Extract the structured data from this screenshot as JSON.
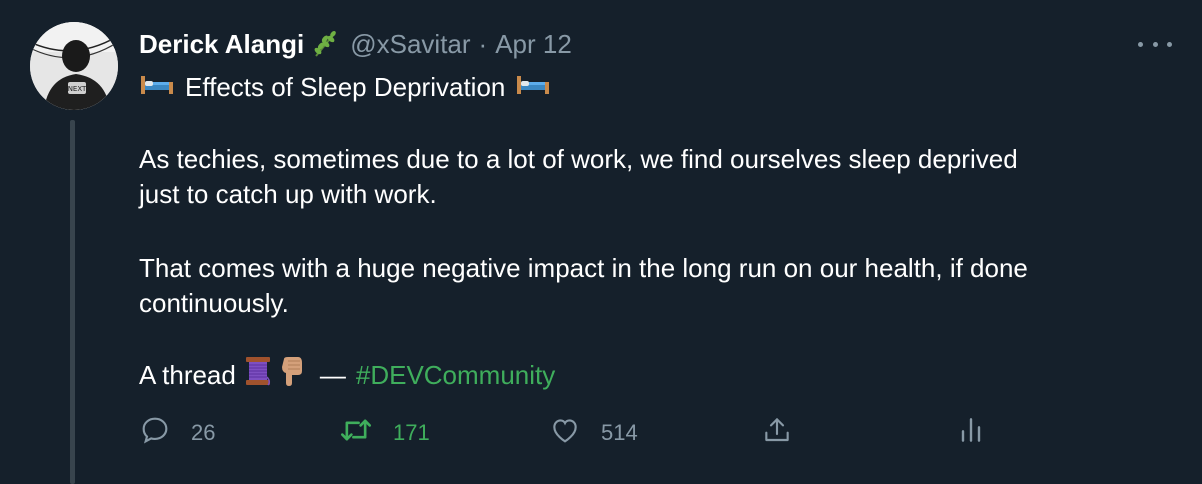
{
  "tweet": {
    "author_name": "Derick Alangi",
    "author_emoji": "🌿",
    "handle": "@xSavitar",
    "separator": "·",
    "date": "Apr 12",
    "title_line": "Effects of Sleep Deprivation",
    "paragraph1_line1": "As techies, sometimes due to a lot of work, we find ourselves sleep deprived",
    "paragraph1_line2": "just to catch up with work.",
    "paragraph2_line1": "That comes with a huge negative impact in the long run on our health, if done",
    "paragraph2_line2": "continuously.",
    "thread_text": "A thread",
    "thread_dash": "—",
    "hashtag": "#DEVCommunity"
  },
  "actions": {
    "reply_count": "26",
    "retweet_count": "171",
    "like_count": "514"
  },
  "icons": {
    "reply": "reply-icon",
    "retweet": "retweet-icon",
    "like": "heart-icon",
    "share": "share-icon",
    "analytics": "analytics-icon",
    "more": "more-icon"
  },
  "colors": {
    "background": "#15202b",
    "text": "#ffffff",
    "secondary": "#8899a6",
    "accent_green": "#3fae5c",
    "thread_line": "#38444d"
  }
}
